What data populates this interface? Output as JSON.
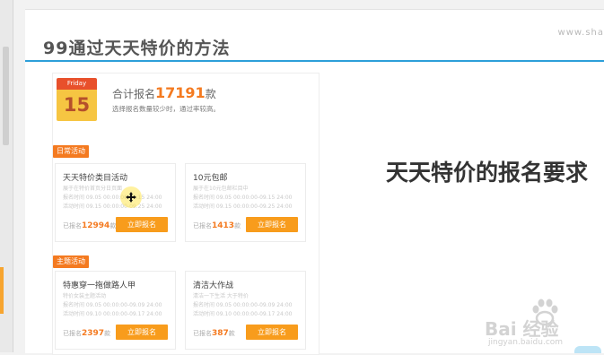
{
  "watermark_top": "www.sha",
  "title": "99通过天天特价的方法",
  "caption": "天天特价的报名要求",
  "calendar": {
    "day_name": "Friday",
    "day_num": "15"
  },
  "summary": {
    "prefix": "合计报名",
    "count": "17191",
    "unit": "款",
    "note": "选择报名数量较少时，通过率较高。"
  },
  "sections": [
    {
      "tag": "日常活动",
      "cards": [
        {
          "title": "天天特价类目活动",
          "line1": "展于在特价首页分日页面",
          "line2": "报名时间 09.05 00:00:00-09.15 24:00",
          "line3": "活动时间 09.15 00:00:00-09.25 24:00",
          "signed_label": "已报名",
          "signed_count": "12994",
          "signed_unit": "款",
          "button": "立即报名"
        },
        {
          "title": "10元包邮",
          "line1": "展于在10元包邮栏目中",
          "line2": "报名时间 09.05 00:00:00-09.15 24:00",
          "line3": "活动时间 09.15 00:00:00-09.25 24:00",
          "signed_label": "已报名",
          "signed_count": "1413",
          "signed_unit": "款",
          "button": "立即报名"
        }
      ]
    },
    {
      "tag": "主题活动",
      "cards": [
        {
          "title": "特惠穿一拖做路人甲",
          "line1": "特价女装主题活动",
          "line2": "报名时间 09.05 00:00:00-09.09 24:00",
          "line3": "活动时间 09.10 00:00:00-09.17 24:00",
          "signed_label": "已报名",
          "signed_count": "2397",
          "signed_unit": "款",
          "button": "立即报名"
        },
        {
          "title": "清洁大作战",
          "line1": "清洁一下生活 大于特价",
          "line2": "报名时间 09.05 00:00:00-09.09 24:00",
          "line3": "活动时间 09.10 00:00:00-09.17 24:00",
          "signed_label": "已报名",
          "signed_count": "387",
          "signed_unit": "款",
          "button": "立即报名"
        }
      ]
    }
  ],
  "baidu": {
    "logo_text": "Bai 经验",
    "url": "jingyan.baidu.com"
  },
  "colors": {
    "accent": "#f47a20",
    "button": "#f89c1c",
    "title_rule": "#2d9fd9"
  }
}
